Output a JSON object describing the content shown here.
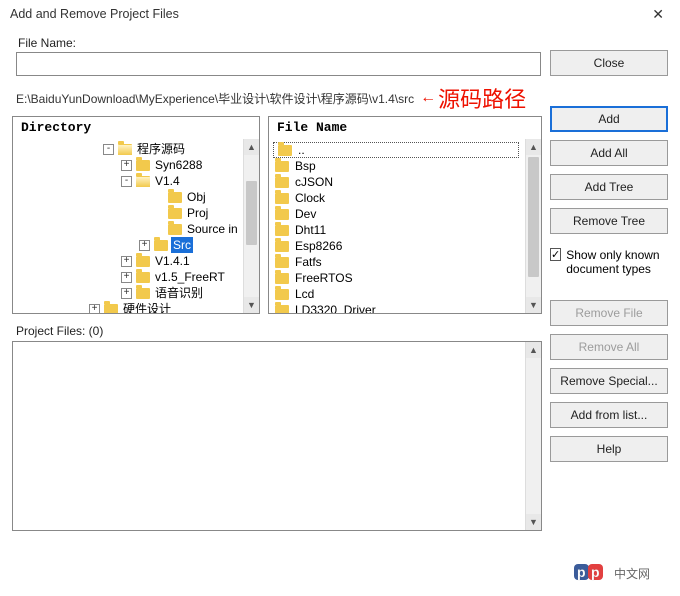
{
  "window": {
    "title": "Add and Remove Project Files"
  },
  "labels": {
    "file_name": "File Name:",
    "directory": "Directory",
    "file_name_panel": "File Name",
    "project_files": "Project Files: (0)"
  },
  "path": {
    "text": "E:\\BaiduYunDownload\\MyExperience\\毕业设计\\软件设计\\程序源码\\v1.4\\src",
    "annotation": "源码路径"
  },
  "tree": [
    {
      "indent": 90,
      "expander": "-",
      "open": true,
      "label": "程序源码"
    },
    {
      "indent": 108,
      "expander": "+",
      "open": false,
      "label": "Syn6288"
    },
    {
      "indent": 108,
      "expander": "-",
      "open": true,
      "label": "V1.4"
    },
    {
      "indent": 140,
      "expander": "",
      "open": false,
      "label": "Obj"
    },
    {
      "indent": 140,
      "expander": "",
      "open": false,
      "label": "Proj"
    },
    {
      "indent": 140,
      "expander": "",
      "open": false,
      "label": "Source in"
    },
    {
      "indent": 126,
      "expander": "+",
      "open": false,
      "label": "Src",
      "selected": true
    },
    {
      "indent": 108,
      "expander": "+",
      "open": false,
      "label": "V1.4.1"
    },
    {
      "indent": 108,
      "expander": "+",
      "open": false,
      "label": "v1.5_FreeRT"
    },
    {
      "indent": 108,
      "expander": "+",
      "open": false,
      "label": "语音识别"
    },
    {
      "indent": 76,
      "expander": "+",
      "open": false,
      "label": "硬件设计"
    }
  ],
  "files": [
    "..",
    "Bsp",
    "cJSON",
    "Clock",
    "Dev",
    "Dht11",
    "Esp8266",
    "Fatfs",
    "FreeRTOS",
    "Lcd",
    "LD3320_Driver"
  ],
  "buttons": {
    "close": "Close",
    "add": "Add",
    "add_all": "Add All",
    "add_tree": "Add Tree",
    "remove_tree": "Remove Tree",
    "remove_file": "Remove File",
    "remove_all": "Remove All",
    "remove_special": "Remove Special...",
    "add_from_list": "Add from list...",
    "help": "Help"
  },
  "checkbox": {
    "label": "Show only known document types",
    "checked": true
  },
  "filename_value": "",
  "watermark": "中文网"
}
